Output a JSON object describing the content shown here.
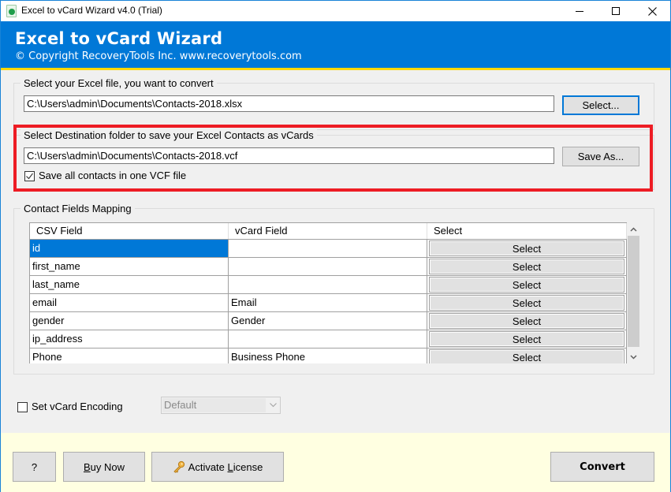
{
  "window": {
    "title": "Excel to vCard Wizard v4.0 (Trial)",
    "controls": {
      "minimize": "minimize",
      "maximize": "maximize",
      "close": "close"
    }
  },
  "banner": {
    "title": "Excel to vCard Wizard",
    "subtitle": "© Copyright RecoveryTools Inc. www.recoverytools.com",
    "background_color": "#0078d7",
    "accent_line_color": "#ffd800"
  },
  "source": {
    "legend": "Select your Excel file, you want to convert",
    "path": "C:\\Users\\admin\\Documents\\Contacts-2018.xlsx",
    "button_label": "Select..."
  },
  "destination": {
    "legend": "Select Destination folder to save your Excel Contacts as vCards",
    "path": "C:\\Users\\admin\\Documents\\Contacts-2018.vcf",
    "button_label": "Save As...",
    "one_file_label": "Save all contacts in one VCF file",
    "one_file_checked": true,
    "highlight_color": "#ed1c24"
  },
  "mapping": {
    "legend": "Contact Fields Mapping",
    "columns": [
      "CSV Field",
      "vCard Field",
      "Select"
    ],
    "rows": [
      {
        "csv": "id",
        "vcard": "",
        "action": "Select",
        "selected": true
      },
      {
        "csv": "first_name",
        "vcard": "",
        "action": "Select"
      },
      {
        "csv": "last_name",
        "vcard": "",
        "action": "Select"
      },
      {
        "csv": "email",
        "vcard": "Email",
        "action": "Select"
      },
      {
        "csv": "gender",
        "vcard": "Gender",
        "action": "Select"
      },
      {
        "csv": "ip_address",
        "vcard": "",
        "action": "Select"
      },
      {
        "csv": "Phone",
        "vcard": "Business Phone",
        "action": "Select"
      }
    ]
  },
  "encoding": {
    "label": "Set vCard Encoding",
    "checked": false,
    "selected_value": "Default"
  },
  "footer": {
    "help_label": "?",
    "buy_label_accel": "B",
    "buy_label_rest": "uy Now",
    "activate_label_pre": "Activate ",
    "activate_label_accel": "L",
    "activate_label_rest": "icense",
    "convert_label": "Convert",
    "background_color": "#ffffe1"
  }
}
